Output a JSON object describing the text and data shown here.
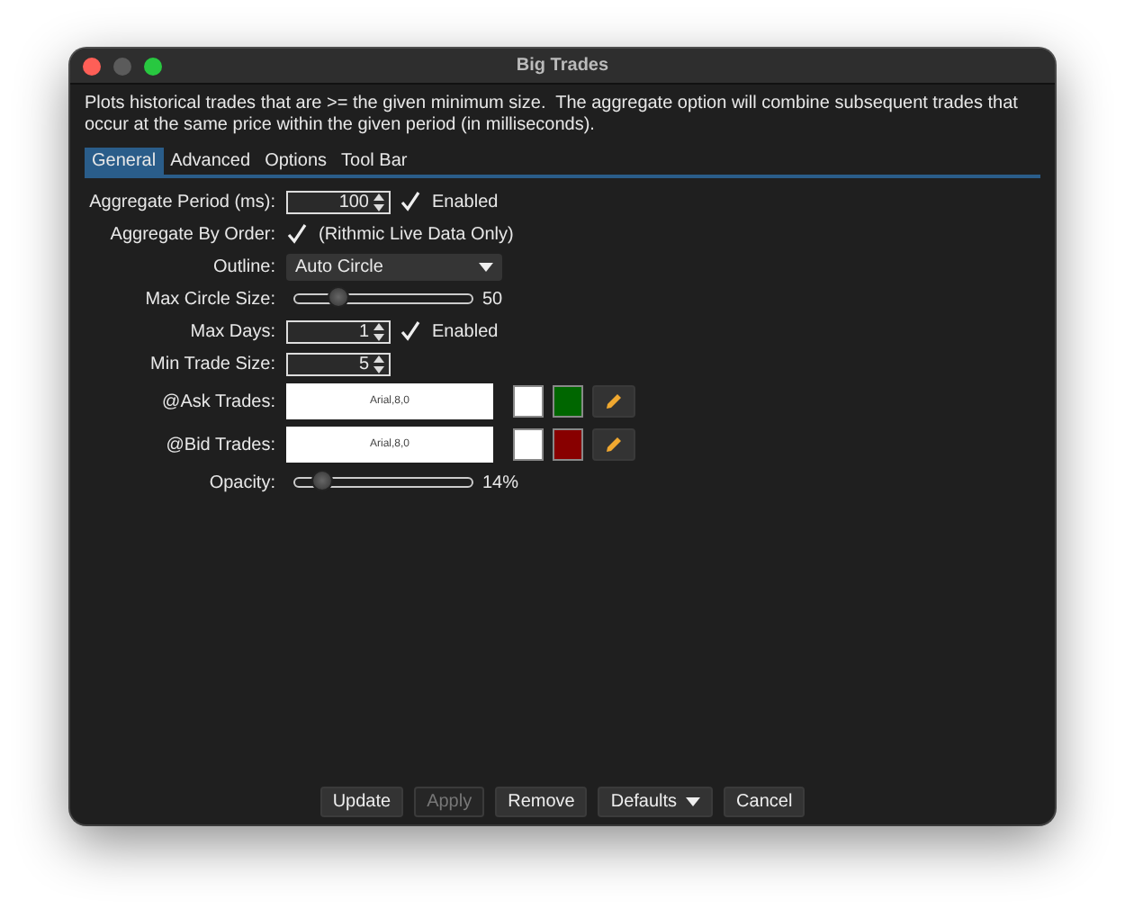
{
  "window": {
    "title": "Big Trades"
  },
  "description": "Plots historical trades that are >= the given minimum size.  The aggregate option will combine subsequent trades that occur at the same price within the given period (in milliseconds).",
  "tabs": [
    {
      "label": "General",
      "selected": true
    },
    {
      "label": "Advanced",
      "selected": false
    },
    {
      "label": "Options",
      "selected": false
    },
    {
      "label": "Tool Bar",
      "selected": false
    }
  ],
  "rows": [
    {
      "kind": "spinner",
      "label": "Aggregate Period (ms):",
      "value": "100",
      "option": {
        "label": "Enabled",
        "checked": true
      }
    },
    {
      "kind": "checkbox",
      "label": "Aggregate By Order:",
      "checked": true,
      "text": "(Rithmic Live Data Only)"
    },
    {
      "kind": "dropdown",
      "label": "Outline:",
      "value": "Auto Circle"
    },
    {
      "kind": "slider",
      "label": "Max Circle Size:",
      "level": 0.24,
      "reading": "50"
    },
    {
      "kind": "spinner",
      "label": "Max Days:",
      "value": "1",
      "option": {
        "label": "Enabled",
        "checked": true
      }
    },
    {
      "kind": "spinner",
      "label": "Min Trade Size:",
      "value": "5"
    },
    {
      "kind": "font",
      "label": "@Ask Trades:",
      "font": "Arial,8,0",
      "swatches": [
        {
          "color": "#ffffff"
        },
        {
          "color": "#006600"
        }
      ]
    },
    {
      "kind": "font",
      "label": "@Bid Trades:",
      "font": "Arial,8,0",
      "swatches": [
        {
          "color": "#ffffff"
        },
        {
          "color": "#880000"
        }
      ]
    },
    {
      "kind": "slider",
      "label": "Opacity:",
      "level": 0.15,
      "reading": "14%"
    }
  ],
  "buttons": [
    {
      "label": "Update",
      "disabled": false,
      "kind": "plain"
    },
    {
      "label": "Apply",
      "disabled": true,
      "kind": "plain"
    },
    {
      "label": "Remove",
      "disabled": false,
      "kind": "plain"
    },
    {
      "label": "Defaults",
      "disabled": false,
      "kind": "menu"
    },
    {
      "label": "Cancel",
      "disabled": false,
      "kind": "plain"
    }
  ]
}
